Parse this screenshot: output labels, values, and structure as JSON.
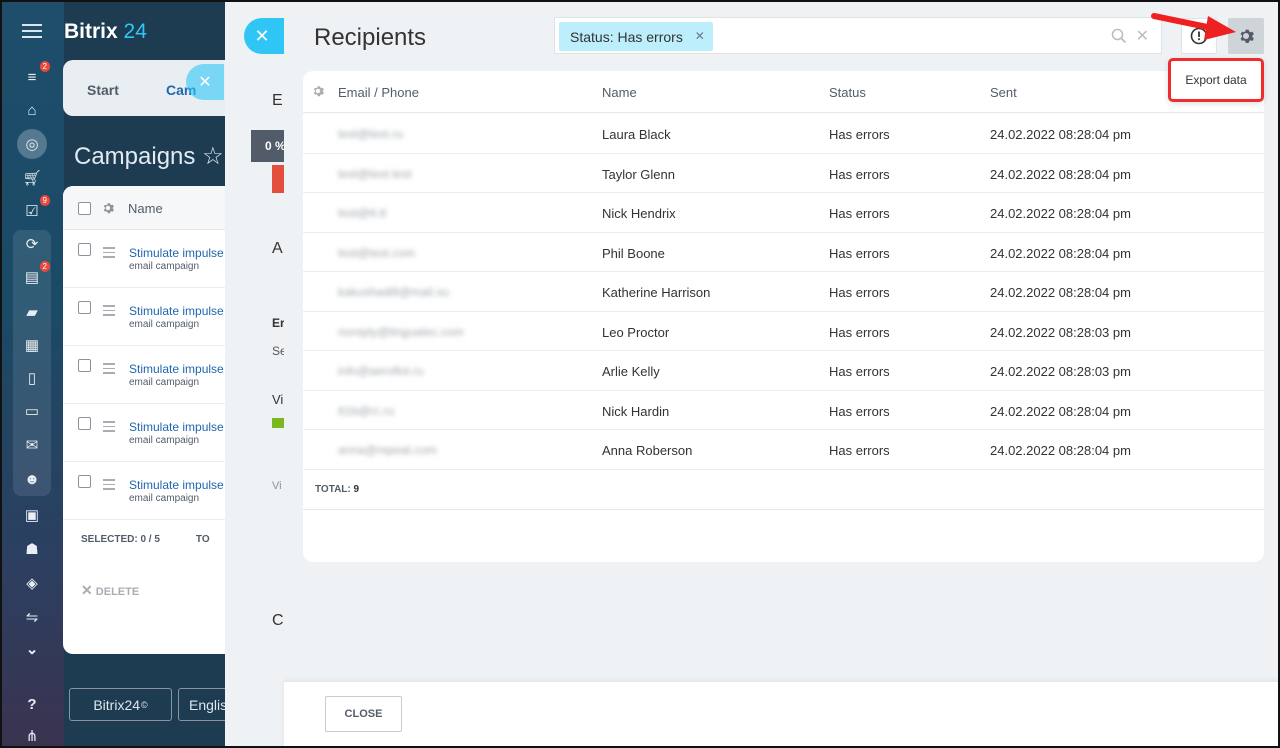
{
  "app": {
    "logo_text": "Bitrix",
    "logo_num": "24"
  },
  "sidebar": {
    "icons": [
      {
        "name": "filter-icon",
        "badge": "2"
      },
      {
        "name": "bank-icon",
        "badge": ""
      },
      {
        "name": "target-icon",
        "badge": ""
      },
      {
        "name": "cart-icon",
        "badge": ""
      },
      {
        "name": "tasks-icon",
        "badge": "9"
      },
      {
        "name": "crm-icon",
        "badge": ""
      },
      {
        "name": "feed-icon",
        "badge": "2"
      },
      {
        "name": "chat-icon",
        "badge": ""
      },
      {
        "name": "calendar-icon",
        "badge": ""
      },
      {
        "name": "document-icon",
        "badge": ""
      },
      {
        "name": "drive-icon",
        "badge": ""
      },
      {
        "name": "mail-icon",
        "badge": ""
      },
      {
        "name": "users-icon",
        "badge": ""
      },
      {
        "name": "contact-card-icon",
        "badge": ""
      },
      {
        "name": "robot-icon",
        "badge": ""
      },
      {
        "name": "box-icon",
        "badge": ""
      },
      {
        "name": "sliders-icon",
        "badge": ""
      },
      {
        "name": "more-icon",
        "badge": ""
      },
      {
        "name": "help-icon",
        "badge": ""
      },
      {
        "name": "sitemap-icon",
        "badge": ""
      }
    ]
  },
  "background": {
    "tab_start": "Start",
    "tab_campaigns": "Cam",
    "title": "Campaigns",
    "col_name": "Name",
    "rows": [
      {
        "link": "Stimulate impulse",
        "type": "email campaign"
      },
      {
        "link": "Stimulate impulse",
        "type": "email campaign"
      },
      {
        "link": "Stimulate impulse",
        "type": "email campaign"
      },
      {
        "link": "Stimulate impulse",
        "type": "email campaign"
      },
      {
        "link": "Stimulate impulse",
        "type": "email campaign"
      }
    ],
    "selected": "SELECTED: 0 / 5",
    "total_short": "TO",
    "delete": "DELETE",
    "bottom_logo": "Bitrix24",
    "bottom_lang": "Englis"
  },
  "mid": {
    "letters": [
      "E",
      "A",
      "Er",
      "Se",
      "Vi",
      "Vi",
      "C"
    ],
    "progress": "0 %"
  },
  "slider": {
    "title": "Recipients",
    "filter_chip": "Status: Has errors",
    "menu_item": "Export data",
    "columns": [
      "Email / Phone",
      "Name",
      "Status",
      "Sent"
    ],
    "rows": [
      {
        "email": "test@test.ru",
        "name": "Laura Black",
        "status": "Has errors",
        "sent": "24.02.2022 08:28:04 pm"
      },
      {
        "email": "test@test.test",
        "name": "Taylor Glenn",
        "status": "Has errors",
        "sent": "24.02.2022 08:28:04 pm"
      },
      {
        "email": "test@tt.tt",
        "name": "Nick Hendrix",
        "status": "Has errors",
        "sent": "24.02.2022 08:28:04 pm"
      },
      {
        "email": "test@test.com",
        "name": "Phil Boone",
        "status": "Has errors",
        "sent": "24.02.2022 08:28:04 pm"
      },
      {
        "email": "kakushadi8@mail.su",
        "name": "Katherine Harrison",
        "status": "Has errors",
        "sent": "24.02.2022 08:28:04 pm"
      },
      {
        "email": "noreply@linguatec.com",
        "name": "Leo Proctor",
        "status": "Has errors",
        "sent": "24.02.2022 08:28:03 pm"
      },
      {
        "email": "info@aeroflot.ru",
        "name": "Arlie Kelly",
        "status": "Has errors",
        "sent": "24.02.2022 08:28:03 pm"
      },
      {
        "email": "tt1b@rc.ru",
        "name": "Nick Hardin",
        "status": "Has errors",
        "sent": "24.02.2022 08:28:04 pm"
      },
      {
        "email": "anna@repeat.com",
        "name": "Anna Roberson",
        "status": "Has errors",
        "sent": "24.02.2022 08:28:04 pm"
      }
    ],
    "total_label": "TOTAL:",
    "total_value": "9",
    "close_label": "CLOSE"
  },
  "colors": {
    "accent": "#2fc6f6",
    "highlight": "#ef2d2d",
    "chip": "#bdeefc"
  }
}
